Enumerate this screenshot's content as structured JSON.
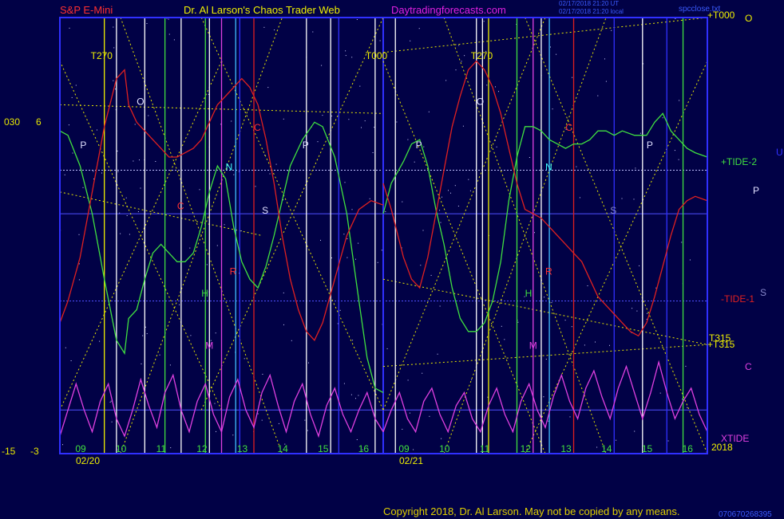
{
  "header": {
    "instrument": "S&P E-Mini",
    "site": "Dr. Al Larson's Chaos Trader Web",
    "url": "Daytradingforecasts.com",
    "stamp1": "02/17/2018 21:20 UT",
    "stamp2": "02/17/2018 21:20 local",
    "file": "spcclose.txt",
    "copyright": "Copyright 2018, Dr. Al Larson. May not be copied by any means.",
    "corner_num": "070670268395"
  },
  "colors": {
    "background": "#010146",
    "plot_border": "#3030ff",
    "tide_plus": "#40e040",
    "tide_minus": "#e02020",
    "xtide": "#e040e0",
    "diagonals": "#e8e800",
    "header_red": "#ff3030",
    "header_yellow": "#f0f000",
    "header_magenta": "#e020e0"
  },
  "left_scale": {
    "top_a": "030",
    "top_b": "6",
    "bottom_a": "-15",
    "bottom_b": "-3"
  },
  "right_labels": {
    "t000": "+T000",
    "o": "O",
    "tide2": "+TIDE-2",
    "u": "U",
    "p": "P",
    "tide1": "-TIDE-1",
    "s": "S",
    "t315a": "T315",
    "t315b": "+T315",
    "c": "C",
    "xtide": "XTIDE",
    "year": "2018"
  },
  "icons": {
    "star_field": "star-field-icon"
  },
  "chart_data": {
    "type": "line",
    "title": "S&P E-Mini",
    "dates": [
      "02/20",
      "02/21"
    ],
    "x_ticks": [
      "09",
      "10",
      "11",
      "12",
      "13",
      "14",
      "15",
      "16",
      "09",
      "10",
      "11",
      "12",
      "13",
      "14",
      "15",
      "16"
    ],
    "x_range": [
      8.5,
      16.5
    ],
    "ylim": [
      0,
      100
    ],
    "grid": true,
    "top_labels": [
      "T270",
      "T000",
      "T270"
    ],
    "series": [
      {
        "name": "+TIDE-2",
        "color": "#40e040",
        "day1": [
          [
            8.5,
            74
          ],
          [
            8.7,
            73
          ],
          [
            9.0,
            66
          ],
          [
            9.3,
            55
          ],
          [
            9.6,
            40
          ],
          [
            9.9,
            26
          ],
          [
            10.1,
            23
          ],
          [
            10.2,
            31
          ],
          [
            10.4,
            33
          ],
          [
            10.6,
            40
          ],
          [
            10.8,
            46
          ],
          [
            11.0,
            48
          ],
          [
            11.2,
            46
          ],
          [
            11.4,
            44
          ],
          [
            11.6,
            44
          ],
          [
            11.8,
            46
          ],
          [
            12.0,
            52
          ],
          [
            12.2,
            60
          ],
          [
            12.4,
            66
          ],
          [
            12.6,
            63
          ],
          [
            12.8,
            52
          ],
          [
            13.0,
            44
          ],
          [
            13.2,
            40
          ],
          [
            13.4,
            38
          ],
          [
            13.6,
            43
          ],
          [
            13.8,
            50
          ],
          [
            14.0,
            58
          ],
          [
            14.2,
            66
          ],
          [
            14.5,
            72
          ],
          [
            14.8,
            76
          ],
          [
            15.0,
            75
          ],
          [
            15.3,
            68
          ],
          [
            15.6,
            55
          ],
          [
            15.9,
            35
          ],
          [
            16.1,
            22
          ],
          [
            16.3,
            15
          ],
          [
            16.5,
            14
          ]
        ],
        "day2": [
          [
            8.5,
            55
          ],
          [
            8.7,
            62
          ],
          [
            9.0,
            67
          ],
          [
            9.2,
            71
          ],
          [
            9.4,
            72
          ],
          [
            9.6,
            66
          ],
          [
            9.8,
            56
          ],
          [
            10.0,
            48
          ],
          [
            10.2,
            38
          ],
          [
            10.4,
            31
          ],
          [
            10.6,
            28
          ],
          [
            10.8,
            28
          ],
          [
            11.0,
            30
          ],
          [
            11.2,
            35
          ],
          [
            11.4,
            44
          ],
          [
            11.6,
            58
          ],
          [
            11.8,
            68
          ],
          [
            12.0,
            75
          ],
          [
            12.2,
            75
          ],
          [
            12.4,
            74
          ],
          [
            12.6,
            72
          ],
          [
            12.8,
            71
          ],
          [
            13.0,
            70
          ],
          [
            13.2,
            71
          ],
          [
            13.4,
            71
          ],
          [
            13.6,
            72
          ],
          [
            13.8,
            74
          ],
          [
            14.0,
            74
          ],
          [
            14.2,
            73
          ],
          [
            14.4,
            74
          ],
          [
            14.7,
            73
          ],
          [
            15.0,
            73
          ],
          [
            15.2,
            76
          ],
          [
            15.4,
            78
          ],
          [
            15.6,
            74
          ],
          [
            15.8,
            72
          ],
          [
            16.0,
            70
          ],
          [
            16.2,
            69
          ],
          [
            16.5,
            68
          ]
        ]
      },
      {
        "name": "-TIDE-1",
        "color": "#e02020",
        "day1": [
          [
            8.5,
            30
          ],
          [
            8.7,
            35
          ],
          [
            9.0,
            45
          ],
          [
            9.3,
            60
          ],
          [
            9.6,
            75
          ],
          [
            9.9,
            86
          ],
          [
            10.1,
            88
          ],
          [
            10.2,
            80
          ],
          [
            10.4,
            76
          ],
          [
            10.6,
            74
          ],
          [
            10.8,
            72
          ],
          [
            11.0,
            70
          ],
          [
            11.2,
            68
          ],
          [
            11.4,
            68
          ],
          [
            11.6,
            69
          ],
          [
            11.8,
            70
          ],
          [
            12.0,
            72
          ],
          [
            12.2,
            76
          ],
          [
            12.4,
            80
          ],
          [
            12.6,
            82
          ],
          [
            12.8,
            84
          ],
          [
            13.0,
            86
          ],
          [
            13.2,
            84
          ],
          [
            13.4,
            80
          ],
          [
            13.6,
            72
          ],
          [
            13.8,
            62
          ],
          [
            14.0,
            50
          ],
          [
            14.2,
            40
          ],
          [
            14.4,
            33
          ],
          [
            14.6,
            28
          ],
          [
            14.8,
            26
          ],
          [
            15.0,
            30
          ],
          [
            15.3,
            40
          ],
          [
            15.6,
            50
          ],
          [
            15.9,
            56
          ],
          [
            16.2,
            58
          ],
          [
            16.5,
            57
          ]
        ],
        "day2": [
          [
            8.5,
            62
          ],
          [
            8.7,
            56
          ],
          [
            9.0,
            45
          ],
          [
            9.2,
            40
          ],
          [
            9.4,
            38
          ],
          [
            9.6,
            45
          ],
          [
            9.8,
            55
          ],
          [
            10.0,
            65
          ],
          [
            10.2,
            75
          ],
          [
            10.4,
            82
          ],
          [
            10.6,
            88
          ],
          [
            10.8,
            90
          ],
          [
            11.0,
            88
          ],
          [
            11.2,
            84
          ],
          [
            11.4,
            78
          ],
          [
            11.6,
            70
          ],
          [
            11.8,
            62
          ],
          [
            12.0,
            56
          ],
          [
            12.2,
            55
          ],
          [
            12.4,
            54
          ],
          [
            12.6,
            52
          ],
          [
            12.8,
            50
          ],
          [
            13.0,
            48
          ],
          [
            13.2,
            46
          ],
          [
            13.4,
            44
          ],
          [
            13.6,
            40
          ],
          [
            13.8,
            36
          ],
          [
            14.0,
            34
          ],
          [
            14.2,
            32
          ],
          [
            14.4,
            30
          ],
          [
            14.6,
            28
          ],
          [
            14.8,
            27
          ],
          [
            15.0,
            30
          ],
          [
            15.2,
            36
          ],
          [
            15.4,
            43
          ],
          [
            15.6,
            50
          ],
          [
            15.8,
            56
          ],
          [
            16.0,
            58
          ],
          [
            16.2,
            59
          ],
          [
            16.5,
            58
          ]
        ]
      },
      {
        "name": "XTIDE",
        "color": "#e040e0",
        "day1": [
          [
            8.5,
            4
          ],
          [
            8.7,
            10
          ],
          [
            8.9,
            16
          ],
          [
            9.1,
            10
          ],
          [
            9.3,
            5
          ],
          [
            9.5,
            12
          ],
          [
            9.7,
            16
          ],
          [
            9.9,
            8
          ],
          [
            10.1,
            4
          ],
          [
            10.3,
            10
          ],
          [
            10.5,
            17
          ],
          [
            10.7,
            11
          ],
          [
            10.9,
            6
          ],
          [
            11.1,
            14
          ],
          [
            11.3,
            18
          ],
          [
            11.5,
            10
          ],
          [
            11.7,
            5
          ],
          [
            11.9,
            12
          ],
          [
            12.1,
            16
          ],
          [
            12.3,
            9
          ],
          [
            12.5,
            5
          ],
          [
            12.7,
            13
          ],
          [
            12.9,
            17
          ],
          [
            13.1,
            10
          ],
          [
            13.3,
            6
          ],
          [
            13.5,
            14
          ],
          [
            13.7,
            18
          ],
          [
            13.9,
            11
          ],
          [
            14.1,
            5
          ],
          [
            14.3,
            12
          ],
          [
            14.5,
            16
          ],
          [
            14.7,
            9
          ],
          [
            14.9,
            4
          ],
          [
            15.1,
            11
          ],
          [
            15.3,
            15
          ],
          [
            15.5,
            9
          ],
          [
            15.7,
            5
          ],
          [
            15.9,
            10
          ],
          [
            16.1,
            14
          ],
          [
            16.3,
            8
          ],
          [
            16.5,
            5
          ]
        ],
        "day2": [
          [
            8.5,
            5
          ],
          [
            8.7,
            10
          ],
          [
            8.9,
            14
          ],
          [
            9.1,
            8
          ],
          [
            9.3,
            5
          ],
          [
            9.5,
            12
          ],
          [
            9.7,
            15
          ],
          [
            9.9,
            9
          ],
          [
            10.1,
            5
          ],
          [
            10.3,
            11
          ],
          [
            10.5,
            14
          ],
          [
            10.7,
            8
          ],
          [
            10.9,
            5
          ],
          [
            11.1,
            11
          ],
          [
            11.3,
            15
          ],
          [
            11.5,
            9
          ],
          [
            11.7,
            5
          ],
          [
            11.9,
            12
          ],
          [
            12.1,
            16
          ],
          [
            12.3,
            10
          ],
          [
            12.5,
            6
          ],
          [
            12.7,
            13
          ],
          [
            12.9,
            18
          ],
          [
            13.1,
            12
          ],
          [
            13.3,
            8
          ],
          [
            13.5,
            15
          ],
          [
            13.7,
            19
          ],
          [
            13.9,
            13
          ],
          [
            14.1,
            8
          ],
          [
            14.3,
            15
          ],
          [
            14.5,
            20
          ],
          [
            14.7,
            14
          ],
          [
            14.9,
            8
          ],
          [
            15.1,
            14
          ],
          [
            15.3,
            21
          ],
          [
            15.5,
            14
          ],
          [
            15.7,
            8
          ],
          [
            15.9,
            12
          ],
          [
            16.1,
            15
          ],
          [
            16.3,
            9
          ],
          [
            16.5,
            5
          ]
        ]
      }
    ],
    "day1_labels": [
      {
        "text": "P",
        "x": 9.0,
        "y": 70,
        "color": "#e0e0ff"
      },
      {
        "text": "O",
        "x": 10.4,
        "y": 80,
        "color": "#e0e0ff"
      },
      {
        "text": "C",
        "x": 11.4,
        "y": 56,
        "color": "#ff3030"
      },
      {
        "text": "N",
        "x": 12.6,
        "y": 65,
        "color": "#40ffff"
      },
      {
        "text": "C",
        "x": 13.3,
        "y": 74,
        "color": "#ff3030"
      },
      {
        "text": "S",
        "x": 13.5,
        "y": 55,
        "color": "#e0e0ff"
      },
      {
        "text": "P",
        "x": 14.5,
        "y": 70,
        "color": "#e0e0ff"
      },
      {
        "text": "H",
        "x": 12.0,
        "y": 36,
        "color": "#40e040"
      },
      {
        "text": "R",
        "x": 12.7,
        "y": 41,
        "color": "#ff3030"
      },
      {
        "text": "M",
        "x": 12.1,
        "y": 24,
        "color": "#e040e0"
      }
    ],
    "day2_labels": [
      {
        "text": "P",
        "x": 9.3,
        "y": 70,
        "color": "#e0e0ff"
      },
      {
        "text": "O",
        "x": 10.8,
        "y": 80,
        "color": "#e0e0ff"
      },
      {
        "text": "N",
        "x": 12.5,
        "y": 65,
        "color": "#40ffff"
      },
      {
        "text": "C",
        "x": 13.0,
        "y": 74,
        "color": "#ff3030"
      },
      {
        "text": "S",
        "x": 14.1,
        "y": 55,
        "color": "#8888cc"
      },
      {
        "text": "P",
        "x": 15.0,
        "y": 70,
        "color": "#e0e0ff"
      },
      {
        "text": "H",
        "x": 12.0,
        "y": 36,
        "color": "#40e040"
      },
      {
        "text": "R",
        "x": 12.5,
        "y": 41,
        "color": "#ff3030"
      },
      {
        "text": "M",
        "x": 12.1,
        "y": 24,
        "color": "#e040e0"
      }
    ]
  }
}
